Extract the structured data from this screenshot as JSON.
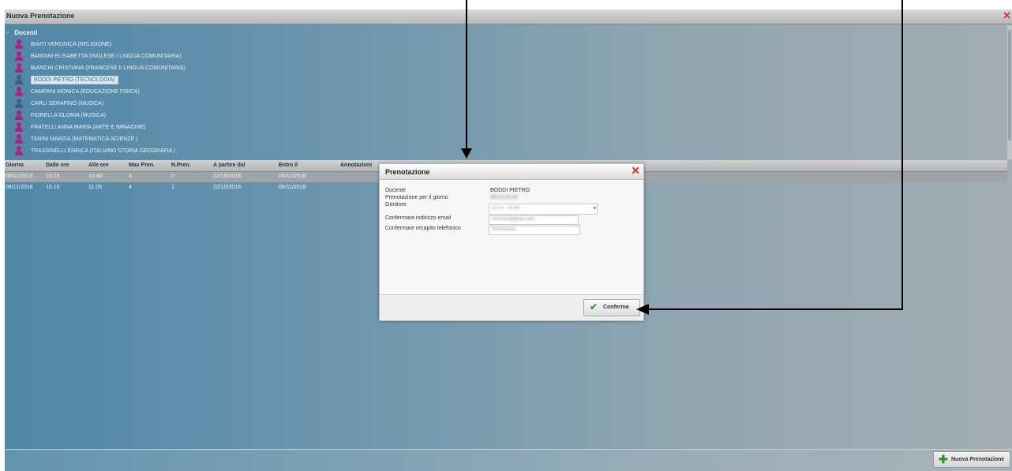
{
  "window": {
    "title": "Nuova Prenotazione"
  },
  "tree": {
    "root_label": "Docenti",
    "items": [
      {
        "label": "BIAITI VERONICA (RELIGIONE)",
        "gender": "female"
      },
      {
        "label": "BARDINI ELISABETTA (INGLESE / LINGUA COMUNITARIA)",
        "gender": "female"
      },
      {
        "label": "BIANCHI CRISTIANA (FRANCESE II LINGUA COMUNITARIA)",
        "gender": "female"
      },
      {
        "label": "BODDI PIETRO (TECNOLOGIA)",
        "gender": "male",
        "selected": true
      },
      {
        "label": "CAMPANI MONICA (EDUCAZIONE FISICA)",
        "gender": "female"
      },
      {
        "label": "CARLI SERAFINO (MUSICA)",
        "gender": "male"
      },
      {
        "label": "FIORELLA GLORIA (MUSICA)",
        "gender": "female"
      },
      {
        "label": "FRATELLI ANNA MARIA (ARTE E IMMAGINE)",
        "gender": "female"
      },
      {
        "label": "TANINI MARZIA (MATEMATICA SCIENZE )",
        "gender": "female"
      },
      {
        "label": "TRASSINELLI ENRICA (ITALIANO STORIA GEOGRAFIA )",
        "gender": "female"
      }
    ]
  },
  "grid": {
    "columns": [
      "Giorno",
      "Dalle ore",
      "Alle ore",
      "Max Pren.",
      "N.Pren.",
      "A partire dal",
      "Entro il",
      "Annotazioni"
    ],
    "rows": [
      [
        "08/11/2018",
        "10.15",
        "10.40",
        "4",
        "0",
        "22/10/2018",
        "06/11/2018",
        ""
      ],
      [
        "08/11/2018",
        "10.15",
        "11.05",
        "4",
        "1",
        "22/10/2018",
        "06/11/2018",
        ""
      ]
    ]
  },
  "dialog": {
    "title": "Prenotazione",
    "fields": {
      "docente_label": "Docente",
      "docente_value": "BODDI PIETRO",
      "giorno_label": "Prenotazione per il giorno",
      "giorno_value": "08/11/2018",
      "genitore_label": "Genitore",
      "genitore_value": "10.15 - 10.40",
      "email_label": "Confermare indirizzo email",
      "email_value": "xxxxxxx@gmail.com",
      "telefono_label": "Confermare recapito telefonico",
      "telefono_value": "xxxxxxxxxx"
    },
    "confirm_label": "Conferma"
  },
  "bottom": {
    "new_button_label": "Nuova Prenotazione"
  },
  "colors": {
    "female_icon": "#b0207a",
    "male_icon": "#3f5f7f",
    "close_red": "#e03030",
    "confirm_check": "#3aa33a",
    "add_green": "#2e9a2e"
  },
  "icons": {
    "window_close": "close-icon",
    "dialog_close": "close-icon",
    "confirm": "check-icon",
    "add": "plus-icon",
    "tree_item_female": "person-icon",
    "tree_item_male": "person-icon"
  }
}
